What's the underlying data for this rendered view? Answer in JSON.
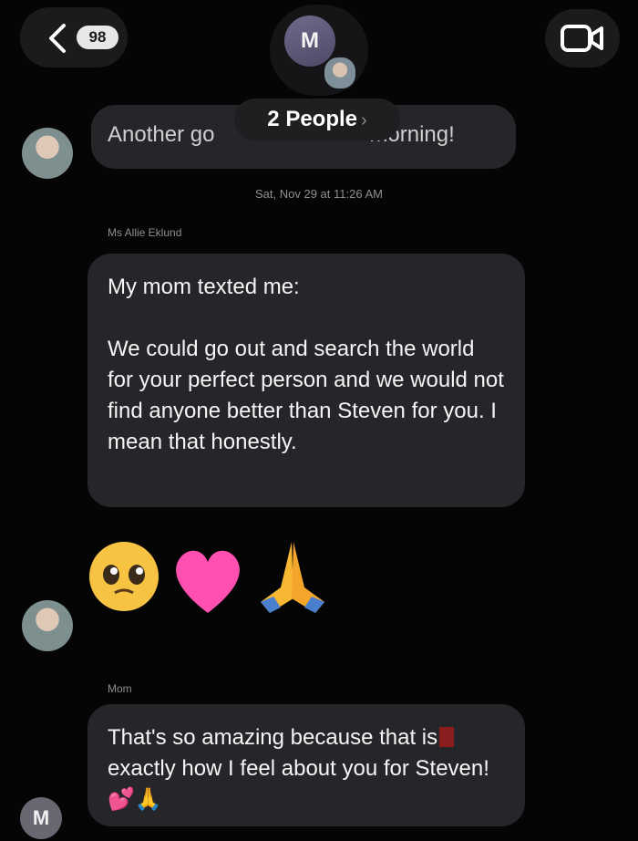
{
  "header": {
    "back_count": "98",
    "group_initial": "M",
    "people_label": "2 People",
    "people_chevron": "›"
  },
  "messages": {
    "first_partial": "Another go",
    "first_end": "morning!",
    "timestamp": "Sat, Nov 29 at 11:26 AM",
    "sender1": "Ms Allie Eklund",
    "mom_text": "My mom texted me:\n\nWe could go out and search the world for your perfect person and we would not find anyone better than Steven for you. I mean that honestly.",
    "emojis": [
      "🥹",
      "🩷",
      "🙏"
    ],
    "sender2": "Mom",
    "reply_part1": "That's so amazing because that is",
    "reply_part2": "exactly how I feel about you for Steven!",
    "reply_emojis": "💕🙏",
    "reply_avatar_initial": "M"
  },
  "icons": {
    "back": "chevron-left-icon",
    "video": "video-camera-icon"
  },
  "colors": {
    "background": "#050505",
    "bubble": "#26262a",
    "meta_text": "#8e8e93"
  }
}
